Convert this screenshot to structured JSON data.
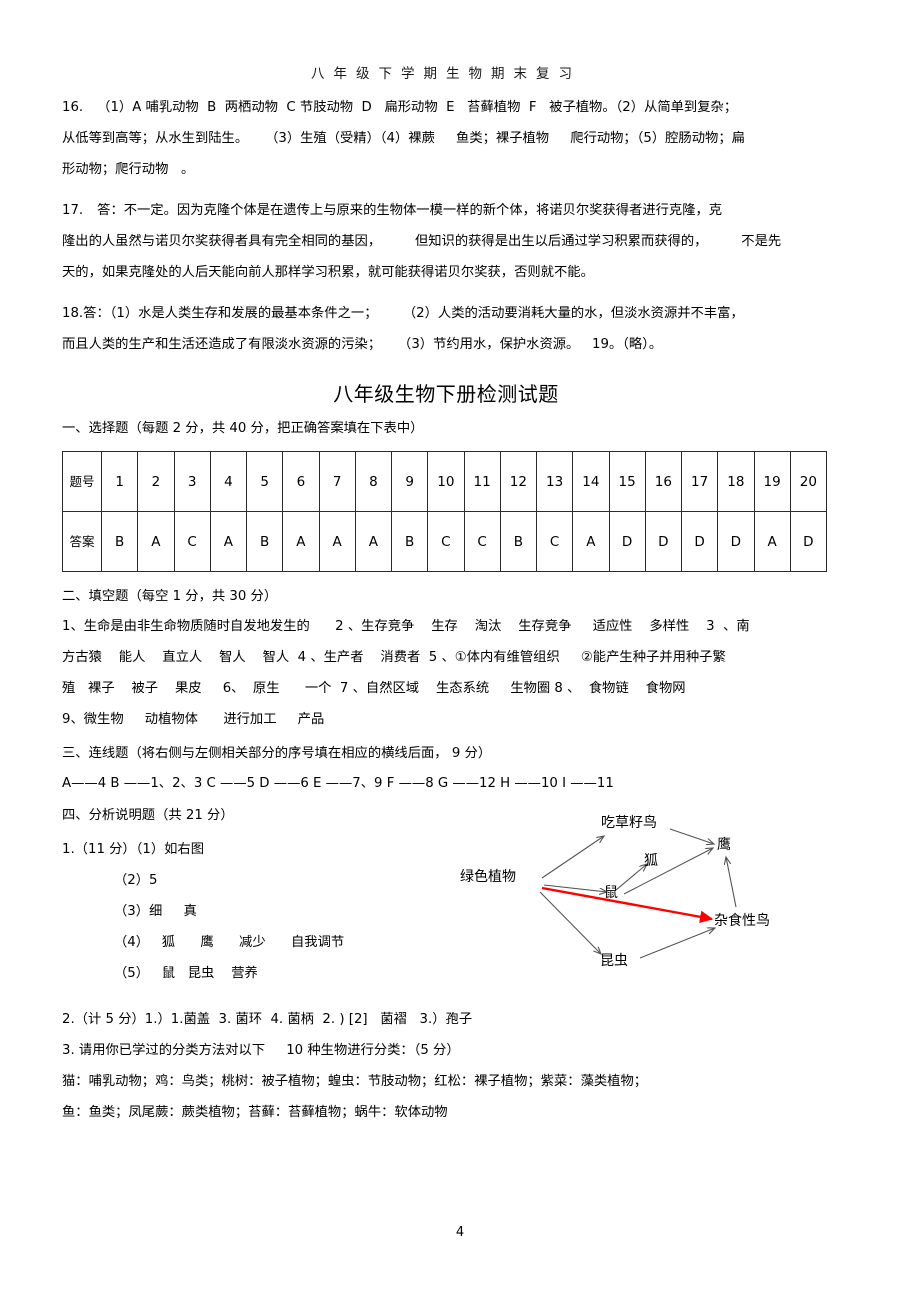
{
  "header": {
    "running_title": "八年级下学期生物期末复习"
  },
  "answers_prev": {
    "q16": {
      "number": "16.",
      "line1": "（1）A 哺乳动物  B  两栖动物  C 节肢动物  D   扁形动物  E   苔藓植物  F   被子植物。（2）从简单到复杂；",
      "line2": "从低等到高等；从水生到陆生。    （3）生殖（受精）（4）裸蕨     鱼类；裸子植物     爬行动物；（5）腔肠动物；扁",
      "line3": "形动物；爬行动物   。"
    },
    "q17": {
      "number": "17.",
      "line1": "答：不一定。因为克隆个体是在遗传上与原来的生物体一模一样的新个体，将诺贝尔奖获得者进行克隆，克",
      "line2": "隆出的人虽然与诺贝尔奖获得者具有完全相同的基因，        但知识的获得是出生以后通过学习积累而获得的，        不是先",
      "line3": "天的，如果克隆处的人后天能向前人那样学习积累，就可能获得诺贝尔奖获，否则就不能。"
    },
    "q18": {
      "number": "18.",
      "line1": "答：（1）水是人类生存和发展的最基本条件之一；      （2）人类的活动要消耗大量的水，但淡水资源并不丰富，",
      "line2": "而且人类的生产和生活还造成了有限淡水资源的污染；    （3）节约用水，保护水资源。   19。（略）。"
    }
  },
  "exam": {
    "title": "八年级生物下册检测试题",
    "section1": {
      "heading": "一、选择题（每题   2 分，共 40 分，把正确答案填在下表中）",
      "table": {
        "row_labels": [
          "题号",
          "答案"
        ],
        "numbers": [
          "1",
          "2",
          "3",
          "4",
          "5",
          "6",
          "7",
          "8",
          "9",
          "10",
          "11",
          "12",
          "13",
          "14",
          "15",
          "16",
          "17",
          "18",
          "19",
          "20"
        ],
        "answers": [
          "B",
          "A",
          "C",
          "A",
          "B",
          "A",
          "A",
          "A",
          "B",
          "C",
          "C",
          "B",
          "C",
          "A",
          "D",
          "D",
          "D",
          "D",
          "A",
          "D"
        ]
      }
    },
    "section2": {
      "heading": "二、填空题（每空   1 分，共 30 分）",
      "line1": "1、生命是由非生命物质随时自发地发生的      2 、生存竞争    生存    淘汰    生存竞争     适应性    多样性    3  、南",
      "line2": "方古猿    能人    直立人    智人    智人  4 、生产者    消费者  5 、①体内有维管组织     ②能产生种子并用种子繁",
      "line3": "殖   裸子    被子    果皮     6、  原生      一个  7 、自然区域    生态系统     生物圈 8 、  食物链    食物网",
      "line4": "9、微生物     动植物体      进行加工     产品"
    },
    "section3": {
      "heading": "三、连线题（将右侧与左侧相关部分的序号填在相应的横线后面，        9 分）",
      "pairs": "A——4 B ——1、2、3 C ——5 D ——6 E ——7、9 F ——8 G ——12 H ——10 I ——11"
    },
    "section4": {
      "heading": "四、分析说明题（共   21 分）",
      "q1": {
        "line1": "1.（11 分）（1）如右图",
        "line2": "（2）5",
        "line3": "（3）细     真",
        "line4": "（4）   狐      鹰      减少      自我调节",
        "line5": "（5）   鼠   昆虫    营养"
      },
      "q2": "2.（计 5 分）1.）1.菌盖  3. 菌环  4. 菌柄  2. ) [2]   菌褶   3.）孢子",
      "q3": {
        "heading": "3. 请用你已学过的分类方法对以下     10 种生物进行分类：（5 分）",
        "line1": "猫：哺乳动物；鸡：鸟类；桃树：被子植物；蝗虫：节肢动物；红松：裸子植物；紫菜：藻类植物；",
        "line2": "鱼：鱼类；凤尾蕨：蕨类植物；苔藓：苔藓植物；蜗牛：软体动物"
      }
    }
  },
  "food_web": {
    "nodes": {
      "producer": "绿色植物",
      "seed_bird": "吃草籽鸟",
      "hawk": "鹰",
      "fox": "狐",
      "mouse": "鼠",
      "omnivore_bird": "杂食性鸟",
      "insect": "昆虫"
    },
    "highlight_color": "#ff0000",
    "arrow_color": "#555555",
    "edges": [
      {
        "from": "绿色植物",
        "to": "吃草籽鸟",
        "highlight": false
      },
      {
        "from": "绿色植物",
        "to": "鼠",
        "highlight": false
      },
      {
        "from": "绿色植物",
        "to": "昆虫",
        "highlight": false
      },
      {
        "from": "绿色植物",
        "to": "杂食性鸟",
        "highlight": true
      },
      {
        "from": "吃草籽鸟",
        "to": "鹰",
        "highlight": false
      },
      {
        "from": "鼠",
        "to": "狐",
        "highlight": false
      },
      {
        "from": "鼠",
        "to": "鹰",
        "highlight": false
      },
      {
        "from": "昆虫",
        "to": "杂食性鸟",
        "highlight": false
      },
      {
        "from": "杂食性鸟",
        "to": "鹰",
        "highlight": false
      }
    ]
  },
  "footer": {
    "page_number": "4"
  }
}
